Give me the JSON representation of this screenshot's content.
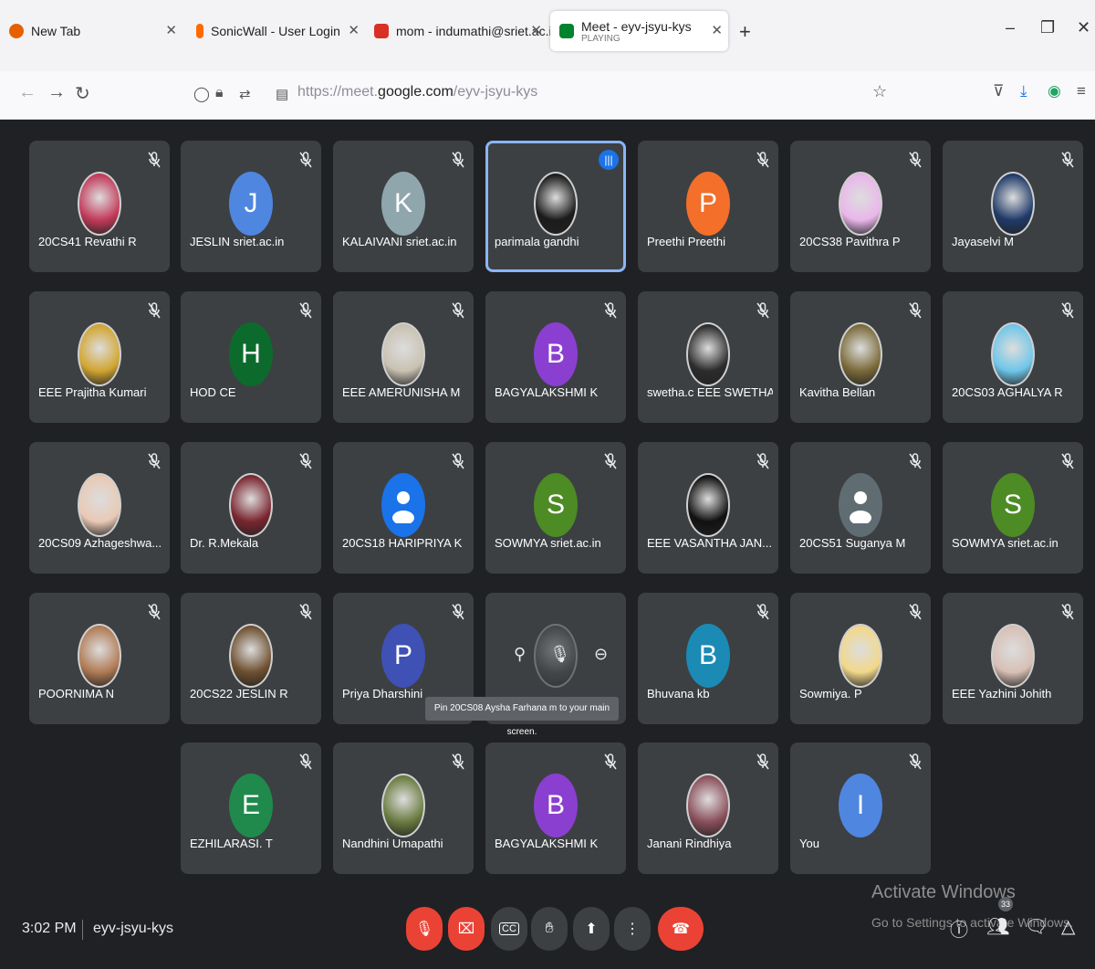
{
  "browser": {
    "tabs": [
      {
        "title": "New Tab",
        "color": "#e66000"
      },
      {
        "title": "SonicWall - User Login",
        "color": "#ff6a00"
      },
      {
        "title": "mom - indumathi@sriet.ac.in",
        "color": "#d93025"
      },
      {
        "title": "Meet - eyv-jsyu-kys",
        "subtitle": "PLAYING",
        "color": "#00832d"
      }
    ],
    "new_tab": "+",
    "window_buttons": [
      "–",
      "❐",
      "✕"
    ],
    "url_prefix": "https://meet.",
    "url_host": "google.com",
    "url_path": "/eyv-jsyu-kys"
  },
  "participants": [
    {
      "name": "20CS41 Revathi R",
      "photo": "#c23a5a"
    },
    {
      "name": "JESLIN sriet.ac.in",
      "initial": "J",
      "color": "#4f86e0"
    },
    {
      "name": "KALAIVANI sriet.ac.in",
      "initial": "K",
      "color": "#8fa6ad"
    },
    {
      "name": "parimala gandhi",
      "photo": "#1b1b1b",
      "speaking": true
    },
    {
      "name": "Preethi Preethi",
      "initial": "P",
      "color": "#f36f2a"
    },
    {
      "name": "20CS38 Pavithra P",
      "photo": "#e9b6ea"
    },
    {
      "name": "Jayaselvi M",
      "photo": "#1f3a68"
    },
    {
      "name": "EEE Prajitha Kumari",
      "photo": "#d2a531"
    },
    {
      "name": "HOD CE",
      "initial": "H",
      "color": "#0c6b2c"
    },
    {
      "name": "EEE AMERUNISHA M",
      "photo": "#c9c2b2"
    },
    {
      "name": "BAGYALAKSHMI K",
      "initial": "B",
      "color": "#8b3fd1"
    },
    {
      "name": "swetha.c EEE SWETHA",
      "photo": "#2c2c2c"
    },
    {
      "name": "Kavitha Bellan",
      "photo": "#7b6a3a"
    },
    {
      "name": "20CS03 AGHALYA R",
      "photo": "#6fc6e9"
    },
    {
      "name": "20CS09 Azhageshwa...",
      "photo": "#e9c9b5"
    },
    {
      "name": "Dr. R.Mekala",
      "photo": "#7a2630"
    },
    {
      "name": "20CS18 HARIPRIYA K",
      "placeholder": true,
      "color": "#1a73e8"
    },
    {
      "name": "SOWMYA sriet.ac.in",
      "initial": "S",
      "color": "#4d8b24"
    },
    {
      "name": "EEE VASANTHA JAN...",
      "photo": "#111111"
    },
    {
      "name": "20CS51 Suganya M",
      "placeholder": true,
      "color": "#5f6d73"
    },
    {
      "name": "SOWMYA sriet.ac.in",
      "initial": "S",
      "color": "#4d8b24"
    },
    {
      "name": "POORNIMA N",
      "photo": "#b07b55"
    },
    {
      "name": "20CS22 JESLIN R",
      "photo": "#6e5030"
    },
    {
      "name": "Priya Dharshini",
      "initial": "P",
      "color": "#3f51b5"
    },
    {
      "name": "20CS08 Aysha Farhana m",
      "hovered": true,
      "photo": "#555555"
    },
    {
      "name": "Bhuvana kb",
      "initial": "B",
      "color": "#1b8ab5"
    },
    {
      "name": "Sowmiya. P",
      "photo": "#f2d88a"
    },
    {
      "name": "EEE Yazhini Johith",
      "photo": "#d7c0b5"
    },
    {
      "name": "EZHILARASI. T",
      "initial": "E",
      "color": "#1f8a4c"
    },
    {
      "name": "Nandhini Umapathi",
      "photo": "#6a7b40"
    },
    {
      "name": "BAGYALAKSHMI K",
      "initial": "B",
      "color": "#8b3fd1"
    },
    {
      "name": "Janani Rindhiya",
      "photo": "#8a4f5a"
    },
    {
      "name": "You",
      "initial": "I",
      "color": "#4f86e0"
    }
  ],
  "hover_tooltip": "Pin 20CS08 Aysha Farhana m to your main screen.",
  "meeting": {
    "time": "3:02 PM",
    "code": "eyv-jsyu-kys",
    "people_count": "33"
  },
  "windows_watermark": {
    "title": "Activate Windows",
    "subtitle": "Go to Settings to activate Windows."
  }
}
